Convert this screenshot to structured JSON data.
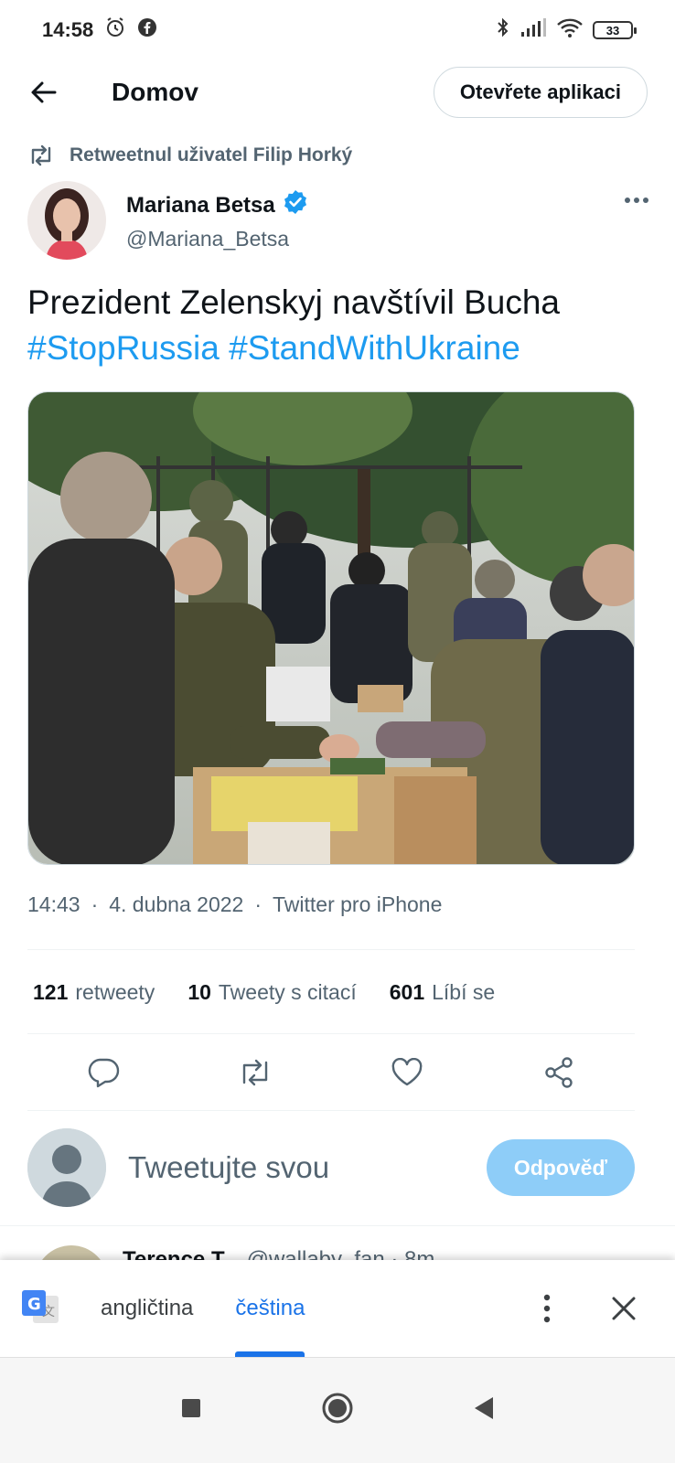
{
  "status": {
    "time": "14:58",
    "battery": "33",
    "icons": [
      "alarm-icon",
      "facebook-icon",
      "bluetooth-icon",
      "signal-icon",
      "wifi-icon",
      "battery-icon"
    ]
  },
  "header": {
    "title": "Domov",
    "open_app_label": "Otevřete aplikaci"
  },
  "tweet": {
    "retweeted_by": "Retweetnul uživatel Filip Horký",
    "author_name": "Mariana Betsa",
    "author_handle": "@Mariana_Betsa",
    "text": "Prezident Zelenskyj navštívil Bucha",
    "hashtags": "#StopRussia #StandWithUkraine",
    "time": "14:43",
    "date": "4. dubna 2022",
    "source": "Twitter pro iPhone",
    "separator": "·"
  },
  "stats": {
    "retweets_count": "121",
    "retweets_label": "retweety",
    "quotes_count": "10",
    "quotes_label": "Tweety s citací",
    "likes_count": "601",
    "likes_label": "Líbí se"
  },
  "reply": {
    "placeholder": "Tweetujte svou",
    "button_label": "Odpověď"
  },
  "next_tweet": {
    "name": "Terence T",
    "handle": "@wallaby_fan · 8m"
  },
  "translate_bar": {
    "source_lang": "angličtina",
    "target_lang": "čeština"
  },
  "colors": {
    "accent": "#1d9bf0",
    "reply_button": "#8ecdf8",
    "translate_active": "#1a73e8"
  }
}
